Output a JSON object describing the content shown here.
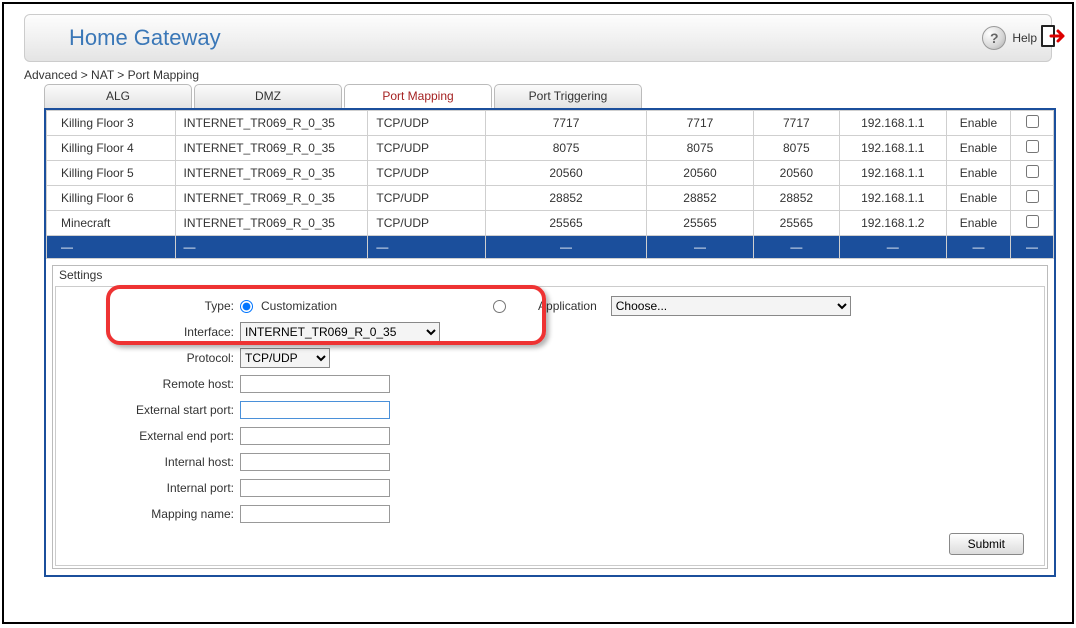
{
  "header": {
    "title": "Home Gateway",
    "help_label": "Help"
  },
  "breadcrumb": "Advanced > NAT > Port Mapping",
  "tabs": [
    {
      "label": "ALG",
      "active": false
    },
    {
      "label": "DMZ",
      "active": false
    },
    {
      "label": "Port Mapping",
      "active": true
    },
    {
      "label": "Port Triggering",
      "active": false
    }
  ],
  "rows": [
    {
      "name": "Killing Floor 3",
      "iface": "INTERNET_TR069_R_0_35",
      "proto": "TCP/UDP",
      "p1": "7717",
      "p2": "7717",
      "p3": "7717",
      "ip": "192.168.1.1",
      "enable": "Enable"
    },
    {
      "name": "Killing Floor 4",
      "iface": "INTERNET_TR069_R_0_35",
      "proto": "TCP/UDP",
      "p1": "8075",
      "p2": "8075",
      "p3": "8075",
      "ip": "192.168.1.1",
      "enable": "Enable"
    },
    {
      "name": "Killing Floor 5",
      "iface": "INTERNET_TR069_R_0_35",
      "proto": "TCP/UDP",
      "p1": "20560",
      "p2": "20560",
      "p3": "20560",
      "ip": "192.168.1.1",
      "enable": "Enable"
    },
    {
      "name": "Killing Floor 6",
      "iface": "INTERNET_TR069_R_0_35",
      "proto": "TCP/UDP",
      "p1": "28852",
      "p2": "28852",
      "p3": "28852",
      "ip": "192.168.1.1",
      "enable": "Enable"
    },
    {
      "name": "Minecraft",
      "iface": "INTERNET_TR069_R_0_35",
      "proto": "TCP/UDP",
      "p1": "25565",
      "p2": "25565",
      "p3": "25565",
      "ip": "192.168.1.2",
      "enable": "Enable"
    }
  ],
  "separator_cell": "—",
  "settings": {
    "title": "Settings",
    "type_label": "Type:",
    "type_option": "Customization",
    "application_label": "Application",
    "application_placeholder": "Choose...",
    "interface_label": "Interface:",
    "interface_value": "INTERNET_TR069_R_0_35",
    "protocol_label": "Protocol:",
    "protocol_value": "TCP/UDP",
    "remote_host_label": "Remote host:",
    "ext_start_label": "External start port:",
    "ext_end_label": "External end port:",
    "int_host_label": "Internal host:",
    "int_port_label": "Internal port:",
    "mapping_name_label": "Mapping name:",
    "submit_label": "Submit"
  }
}
